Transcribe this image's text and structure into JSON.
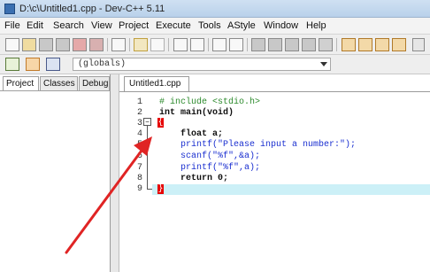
{
  "window": {
    "title": "D:\\c\\Untitled1.cpp - Dev-C++ 5.11"
  },
  "menu": [
    "File",
    "Edit",
    "Search",
    "View",
    "Project",
    "Execute",
    "Tools",
    "AStyle",
    "Window",
    "Help"
  ],
  "toolbar2": {
    "scope_value": "(globals)"
  },
  "left_panel": {
    "tabs": [
      "Project",
      "Classes",
      "Debug"
    ]
  },
  "editor": {
    "tab": "Untitled1.cpp",
    "line_numbers": [
      "1",
      "2",
      "3",
      "4",
      "5",
      "6",
      "7",
      "8",
      "9"
    ],
    "lines": [
      {
        "text": "# include <stdio.h>",
        "class": "pp"
      },
      {
        "text": "int main(void)",
        "class": "kw"
      },
      {
        "text": "{",
        "class": "pl"
      },
      {
        "text": "    float a;",
        "class": "kw"
      },
      {
        "text": "    printf(\"Please input a number:\");",
        "class": "str"
      },
      {
        "text": "    scanf(\"%f\",&a);",
        "class": "str"
      },
      {
        "text": "    printf(\"%f\",a);",
        "class": "str"
      },
      {
        "text": "    return 0;",
        "class": "kw"
      },
      {
        "text": "}",
        "class": "pl"
      }
    ],
    "annotation_color": "#e02424"
  }
}
